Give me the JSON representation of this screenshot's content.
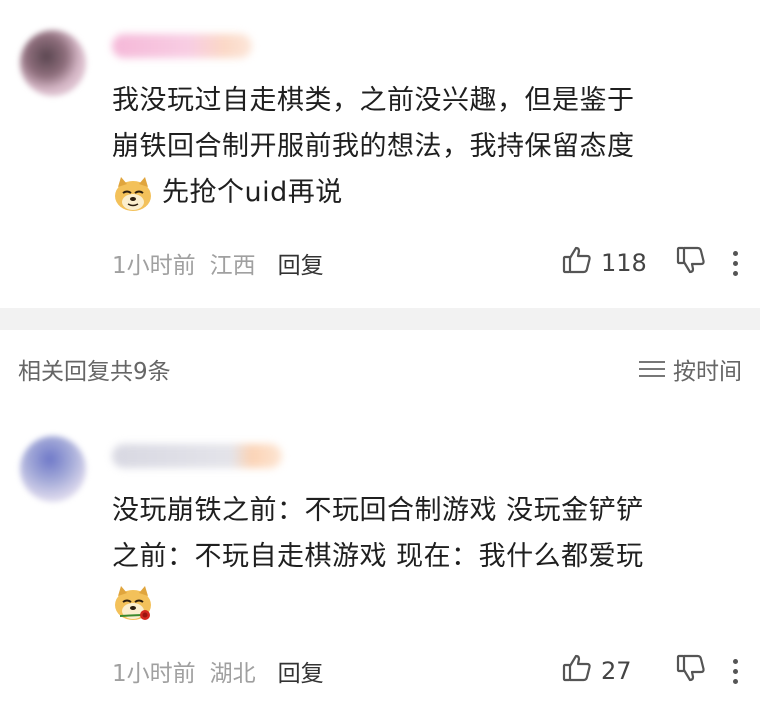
{
  "comments": [
    {
      "text_lines": [
        "我没玩过自走棋类，之前没兴趣，但是鉴于",
        "崩铁回合制开服前我的想法，我持保留态度"
      ],
      "text_tail": "先抢个uid再说",
      "emoji": "doge-emoji",
      "time": "1小时前",
      "location": "江西",
      "reply_label": "回复",
      "likes": "118"
    },
    {
      "text_lines": [
        "没玩崩铁之前：不玩回合制游戏 没玩金铲铲",
        "之前：不玩自走棋游戏 现在：我什么都爱玩"
      ],
      "emoji": "doge-rose-emoji",
      "time": "1小时前",
      "location": "湖北",
      "reply_label": "回复",
      "likes": "27"
    }
  ],
  "replies_header": {
    "count_label": "相关回复共9条",
    "sort_label": "按时间",
    "sort_icon": "menu-lines-icon"
  },
  "icons": {
    "like": "thumbs-up-icon",
    "dislike": "thumbs-down-icon",
    "more": "more-vertical-icon"
  },
  "colors": {
    "meta": "#a0a0a0",
    "divider": "#f2f2f2",
    "text": "#1f1f1f"
  }
}
